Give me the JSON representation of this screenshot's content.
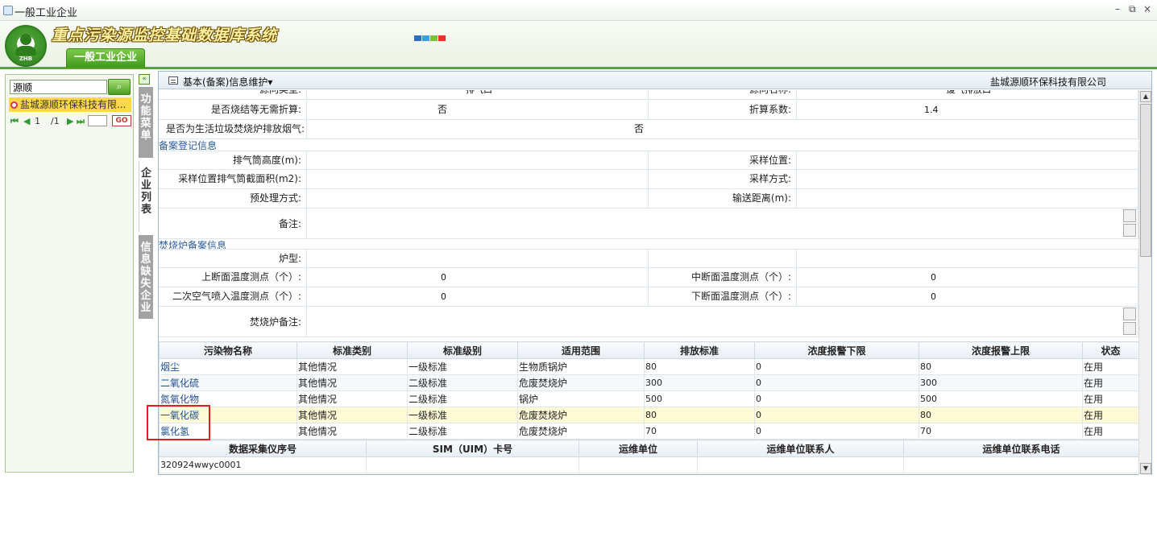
{
  "window": {
    "title": "一般工业企业",
    "min": "–",
    "restore": "⧉",
    "close": "×"
  },
  "header": {
    "system_title": "重点污染源监控基础数据库系统",
    "logo_text": "ZHB",
    "tab_label": "一般工业企业",
    "swatches": [
      "#2f6fc2",
      "#3aa0e0",
      "#78c23a",
      "#e0342a"
    ]
  },
  "left_panel": {
    "search_value": "源顺",
    "search_button": "⌕",
    "result_item": "盐城源顺环保科技有限...",
    "pager": {
      "first": "⏮",
      "prev": "◀",
      "page": "1",
      "total": "/1",
      "next": "▶",
      "last": "⏭",
      "go": "GO"
    }
  },
  "side_tabs": {
    "collapse": "«",
    "menu": "功能菜单",
    "list": "企业列表",
    "missing": "信息缺失企业"
  },
  "content": {
    "heading": "基本(备案)信息维护▾",
    "company": "盐城源顺环保科技有限公司",
    "top_partial": {
      "label1": "源向类型:",
      "value1": "排气口",
      "label2": "源向名称:",
      "value2": "废气排放口"
    },
    "form_rows": [
      {
        "l1": "是否烧结等无需折算:",
        "v1": "否",
        "l2": "折算系数:",
        "v2": "1.4"
      },
      {
        "l1": "是否为生活垃圾焚烧炉排放烟气:",
        "v1": "否"
      }
    ],
    "section_registration": "备案登记信息",
    "reg_rows": [
      {
        "l1": "排气筒高度(m):",
        "v1": "",
        "l2": "采样位置:",
        "v2": ""
      },
      {
        "l1": "采样位置排气筒截面积(m2):",
        "v1": "",
        "l2": "采样方式:",
        "v2": ""
      },
      {
        "l1": "预处理方式:",
        "v1": "",
        "l2": "输送距离(m):",
        "v2": ""
      }
    ],
    "remarks_label": "备注:",
    "section_incinerator": "焚烧炉备案信息",
    "inc_rows": [
      {
        "l1": "炉型:",
        "v1": "",
        "l2": "",
        "v2": ""
      },
      {
        "l1": "上断面温度测点（个）:",
        "v1": "0",
        "l2": "中断面温度测点（个）:",
        "v2": "0"
      },
      {
        "l1": "二次空气喷入温度测点（个）:",
        "v1": "0",
        "l2": "下断面温度测点（个）:",
        "v2": "0"
      }
    ],
    "inc_remarks_label": "焚烧炉备注:",
    "pollutant_table": {
      "headers": [
        "污染物名称",
        "标准类别",
        "标准级别",
        "适用范围",
        "排放标准",
        "浓度报警下限",
        "浓度报警上限",
        "状态"
      ],
      "rows": [
        [
          "烟尘",
          "其他情况",
          "一级标准",
          "生物质锅炉",
          "80",
          "0",
          "80",
          "在用"
        ],
        [
          "二氧化硫",
          "其他情况",
          "二级标准",
          "危废焚烧炉",
          "300",
          "0",
          "300",
          "在用"
        ],
        [
          "氮氧化物",
          "其他情况",
          "二级标准",
          "锅炉",
          "500",
          "0",
          "500",
          "在用"
        ],
        [
          "一氧化碳",
          "其他情况",
          "一级标准",
          "危废焚烧炉",
          "80",
          "0",
          "80",
          "在用"
        ],
        [
          "氯化氢",
          "其他情况",
          "二级标准",
          "危废焚烧炉",
          "70",
          "0",
          "70",
          "在用"
        ]
      ]
    },
    "device_table": {
      "headers": [
        "数据采集仪序号",
        "SIM（UIM）卡号",
        "运维单位",
        "运维单位联系人",
        "运维单位联系电话"
      ],
      "rows": [
        [
          "320924wwyc0001",
          "",
          "",
          "",
          ""
        ]
      ]
    }
  }
}
